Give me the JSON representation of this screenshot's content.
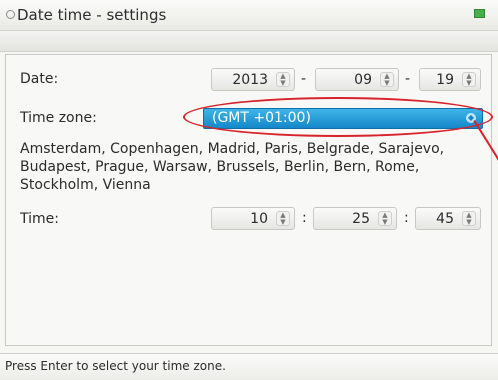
{
  "window": {
    "title": "Date time - settings",
    "title_icon": "settings-dot-icon",
    "status_icon": "battery-icon",
    "status_icon_color": "#48b04a"
  },
  "form": {
    "date_label": "Date:",
    "date_year": "2013",
    "date_month": "09",
    "date_day": "19",
    "date_separator": "-",
    "timezone_label": "Time zone:",
    "timezone_value": "(GMT +01:00)",
    "timezone_cities": "Amsterdam, Copenhagen, Madrid, Paris, Belgrade, Sarajevo, Budapest, Prague, Warsaw, Brussels, Berlin, Bern, Rome, Stockholm, Vienna",
    "time_label": "Time:",
    "time_hours": "10",
    "time_minutes": "25",
    "time_seconds": "45",
    "time_separator": ":"
  },
  "status": {
    "hint": "Press Enter to select your time zone."
  },
  "colors": {
    "selection": "#1587c9",
    "callout": "#d8232a"
  }
}
